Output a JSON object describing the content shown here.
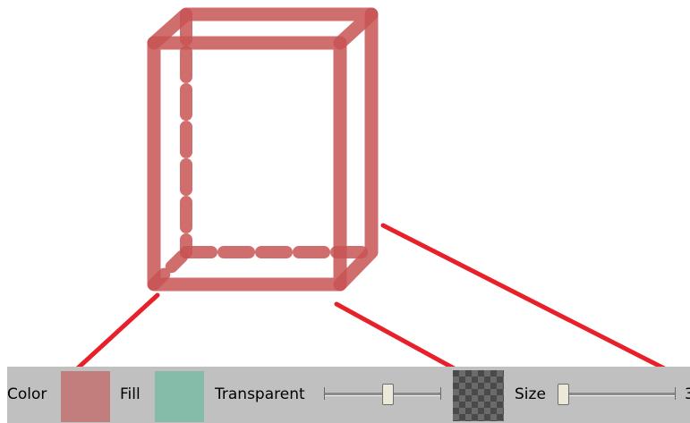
{
  "toolbar": {
    "color_label": "Color",
    "fill_label": "Fill",
    "transparent_label": "Transparent",
    "size_label": "Size",
    "size_value_partial": "3",
    "transparent_level": 0.55,
    "size_level": 0.0
  },
  "colors": {
    "stroke": "#c85454",
    "color_swatch": "#c27d7d",
    "fill_swatch": "#84bca9",
    "annotation": "#e8202a",
    "toolbar_bg": "#c0c0c0"
  },
  "shape": {
    "name": "cube-wireframe",
    "stroke_opacity": 0.85
  },
  "icons": {
    "color": "color-swatch-icon",
    "fill": "fill-swatch-icon",
    "transparency": "checkerboard-icon"
  }
}
